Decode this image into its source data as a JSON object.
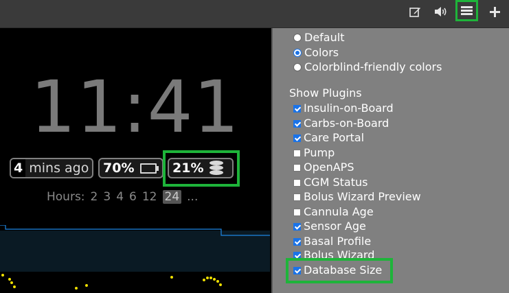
{
  "toolbar": {
    "icons": [
      "edit-icon",
      "audio-icon",
      "menu-icon",
      "add-icon"
    ],
    "highlight_color": "#1eb43a"
  },
  "display": {
    "clock": "11:41",
    "time_ago_value": "4",
    "time_ago_label": "mins ago",
    "battery_pct": "70%",
    "db_pct": "21%",
    "hours_label": "Hours:",
    "hours_options": [
      "2",
      "3",
      "4",
      "6",
      "12",
      "24",
      "..."
    ],
    "hours_selected": "24"
  },
  "settings": {
    "color_options": [
      {
        "label": "Default",
        "selected": false
      },
      {
        "label": "Colors",
        "selected": true
      },
      {
        "label": "Colorblind-friendly colors",
        "selected": false
      }
    ],
    "show_plugins_label": "Show Plugins",
    "plugins": [
      {
        "label": "Insulin-on-Board",
        "checked": true
      },
      {
        "label": "Carbs-on-Board",
        "checked": true
      },
      {
        "label": "Care Portal",
        "checked": true
      },
      {
        "label": "Pump",
        "checked": false
      },
      {
        "label": "OpenAPS",
        "checked": false
      },
      {
        "label": "CGM Status",
        "checked": false
      },
      {
        "label": "Bolus Wizard Preview",
        "checked": false
      },
      {
        "label": "Cannula Age",
        "checked": false
      },
      {
        "label": "Sensor Age",
        "checked": true
      },
      {
        "label": "Basal Profile",
        "checked": true
      },
      {
        "label": "Bolus Wizard",
        "checked": true
      },
      {
        "label": "Database Size",
        "checked": true
      }
    ]
  }
}
